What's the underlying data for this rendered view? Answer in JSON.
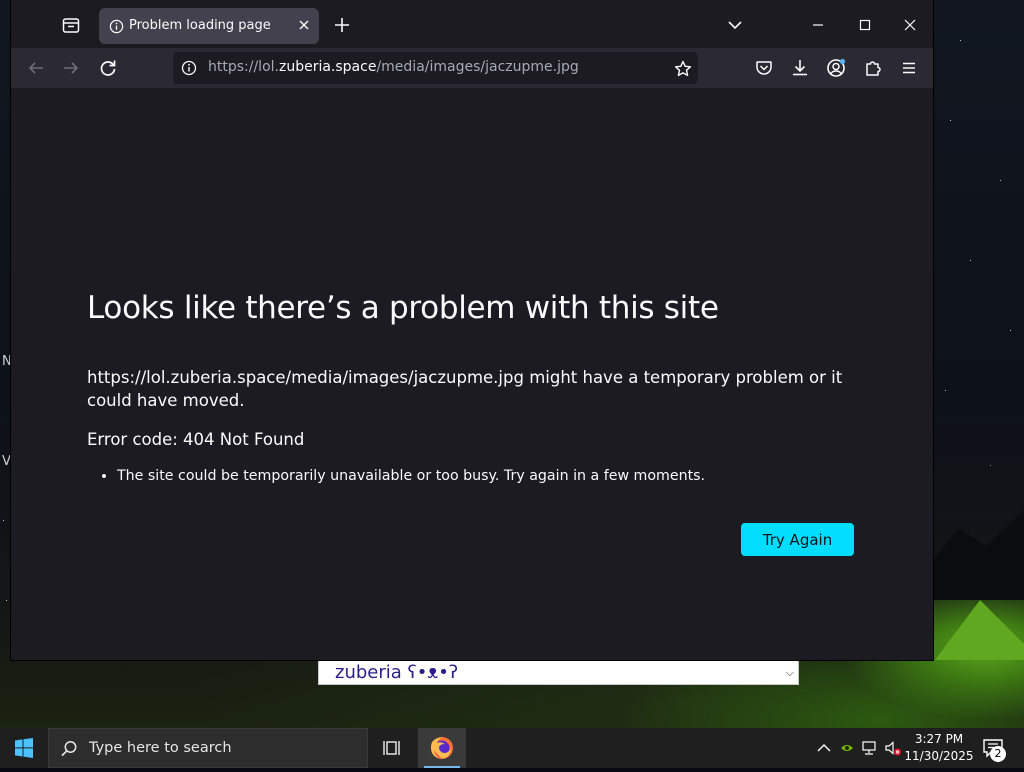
{
  "browser": {
    "tab": {
      "title": "Problem loading page"
    },
    "urlbar": {
      "prefix": "https://lol.",
      "domain": "zuberia.space",
      "path": "/media/images/jaczupme.jpg"
    }
  },
  "error_page": {
    "title": "Looks like there’s a problem with this site",
    "description": "https://lol.zuberia.space/media/images/jaczupme.jpg might have a temporary problem or it could have moved.",
    "error_code": "Error code: 404 Not Found",
    "suggestions": [
      "The site could be temporarily unavailable or too busy. Try again in a few moments."
    ],
    "try_again_label": "Try Again"
  },
  "background_widget": {
    "selected_text": "zuberia ʕ•ᴥ•ʔ"
  },
  "taskbar": {
    "search_placeholder": "Type here to search",
    "time": "3:27 PM",
    "date": "11/30/2025",
    "notification_count": "2"
  },
  "icons": {
    "tab_list": "tab-list-icon",
    "info": "info-icon",
    "close": "close-icon",
    "new_tab": "plus-icon",
    "back": "back-arrow-icon",
    "forward": "forward-arrow-icon",
    "reload": "reload-icon",
    "bookmark": "star-icon",
    "pocket": "pocket-icon",
    "downloads": "download-icon",
    "account": "account-icon",
    "extensions": "puzzle-icon",
    "menu": "hamburger-menu-icon",
    "windows": "windows-logo-icon",
    "search": "search-icon",
    "task_view": "task-view-icon",
    "firefox": "firefox-icon"
  },
  "colors": {
    "accent_button": "#00ddff",
    "window_bg": "#1c1b22",
    "toolbar_bg": "#2b2a33",
    "active_tab_bg": "#42414d"
  }
}
